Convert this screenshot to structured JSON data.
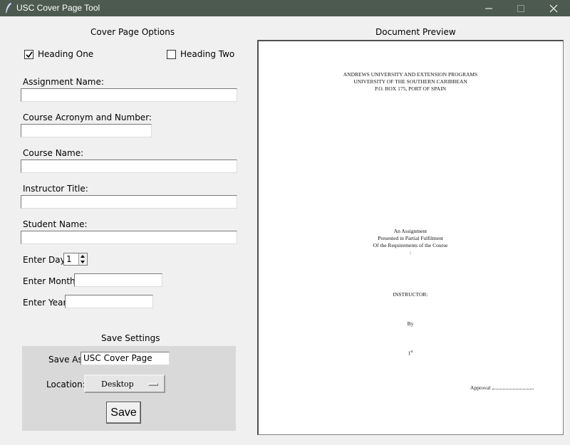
{
  "window": {
    "title": "USC Cover Page Tool",
    "minimize_glyph": "—",
    "maximize_glyph": "☐",
    "close_glyph": "✕"
  },
  "options": {
    "title": "Cover Page Options",
    "heading_one": {
      "label": "Heading One",
      "checked": true
    },
    "heading_two": {
      "label": "Heading Two",
      "checked": false
    }
  },
  "form": {
    "assignment_name": {
      "label": "Assignment Name:",
      "value": ""
    },
    "course_acronym": {
      "label": "Course Acronym and Number:",
      "value": ""
    },
    "course_name": {
      "label": "Course Name:",
      "value": ""
    },
    "instructor_title": {
      "label": "Instructor Title:",
      "value": ""
    },
    "student_name": {
      "label": "Student Name:",
      "value": ""
    },
    "day": {
      "label": "Enter Day:",
      "value": "1"
    },
    "month": {
      "label": "Enter Month:",
      "value": ""
    },
    "year": {
      "label": "Enter Year:",
      "value": ""
    }
  },
  "save": {
    "title": "Save Settings",
    "save_as_label": "Save As:",
    "save_as_value": "USC Cover Page",
    "location_label": "Location:",
    "location_value": "Desktop",
    "save_button": "Save"
  },
  "preview": {
    "title": "Document Preview",
    "header_lines": [
      "ANDREWS UNIVERSITY AND EXTENSION PROGRAMS",
      "UNIVERSITY OF THE SOUTHERN CARIBBEAN",
      "P.O. BOX 175, PORT OF SPAIN"
    ],
    "middle_lines": [
      "An Assignment",
      "Presented in Partial Fulfilment",
      "Of the Requirements of the Course",
      ":"
    ],
    "instructor": "INSTRUCTOR:",
    "by": "By",
    "date": "1",
    "date_suffix": "st",
    "approval": "Approval"
  }
}
